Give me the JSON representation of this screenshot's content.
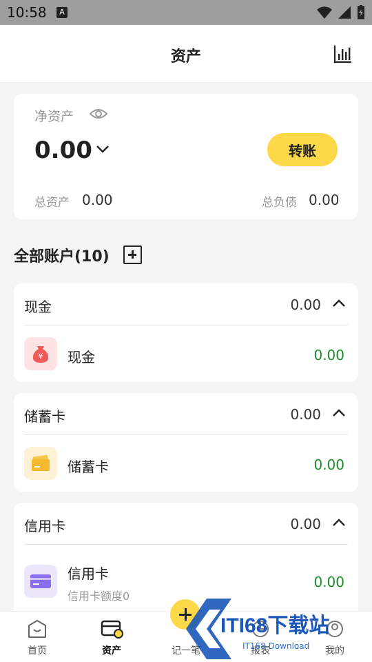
{
  "status_bar": {
    "time": "10:58",
    "notif_icon_letter": "A"
  },
  "header": {
    "title": "资产",
    "chart_icon": "bar-chart-icon"
  },
  "net_assets": {
    "label": "净资产",
    "value": "0.00",
    "transfer_label": "转账",
    "total_assets_label": "总资产",
    "total_assets_value": "0.00",
    "total_liabilities_label": "总负债",
    "total_liabilities_value": "0.00"
  },
  "accounts": {
    "heading": "全部账户(10)",
    "groups": [
      {
        "title": "现金",
        "total": "0.00",
        "items": [
          {
            "name": "现金",
            "amount": "0.00",
            "icon": "money-bag-icon"
          }
        ]
      },
      {
        "title": "储蓄卡",
        "total": "0.00",
        "items": [
          {
            "name": "储蓄卡",
            "amount": "0.00",
            "icon": "savings-card-icon"
          }
        ]
      },
      {
        "title": "信用卡",
        "total": "0.00",
        "items": [
          {
            "name": "信用卡",
            "sub": "信用卡额度0",
            "amount": "0.00",
            "icon": "credit-card-icon"
          }
        ]
      }
    ]
  },
  "tabbar": {
    "tabs": [
      {
        "label": "首页",
        "icon": "home-icon"
      },
      {
        "label": "资产",
        "icon": "wallet-icon",
        "active": true
      },
      {
        "label": "记一笔",
        "icon": "add-record-icon"
      },
      {
        "label": "报表",
        "icon": "report-icon"
      },
      {
        "label": "我的",
        "icon": "profile-icon"
      }
    ]
  },
  "watermark": {
    "text": "ITI68下载站",
    "sub": "IT168 Download"
  },
  "colors": {
    "accent": "#fdd94a",
    "positive": "#1d8a2a",
    "muted": "#999999",
    "background": "#f5f5f5"
  }
}
